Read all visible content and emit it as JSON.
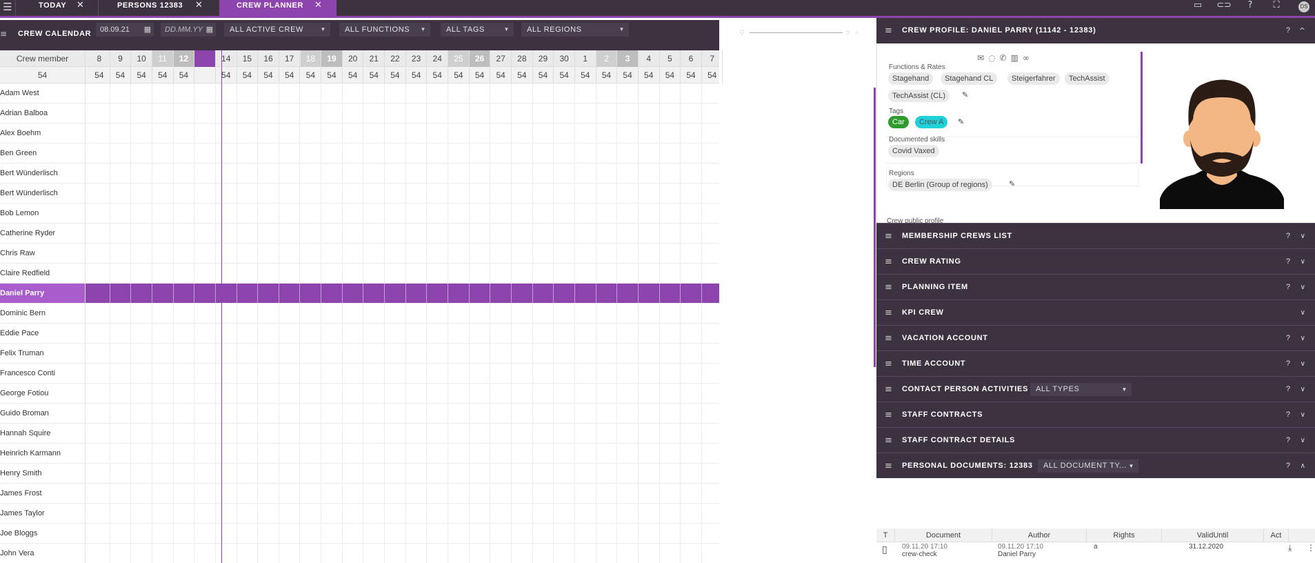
{
  "topbar": {
    "tabs": [
      {
        "label": "TODAY"
      },
      {
        "label": "PERSONS 12383"
      },
      {
        "label": "CREW PLANNER"
      }
    ],
    "close_glyph": "✕",
    "avatar_initials": "DS"
  },
  "toolbar": {
    "title": "CREW CALENDAR",
    "date_from": "08.09.21",
    "date_to_placeholder": "DD.MM.YY",
    "crew_filter": "ALL ACTIVE CREW",
    "function_filter": "ALL FUNCTIONS",
    "tag_filter": "ALL TAGS",
    "region_filter": "ALL REGIONS",
    "help": "?",
    "collapse": "^"
  },
  "calendar": {
    "member_col_header": "Crew member",
    "member_count": "54",
    "days": [
      "8",
      "9",
      "10",
      "11",
      "12",
      "13",
      "14",
      "15",
      "16",
      "17",
      "18",
      "19",
      "20",
      "21",
      "22",
      "23",
      "24",
      "25",
      "26",
      "27",
      "28",
      "29",
      "30",
      "1",
      "2",
      "3",
      "4",
      "5",
      "6",
      "7"
    ],
    "day_counts": [
      "54",
      "54",
      "54",
      "54",
      "54",
      "",
      "54",
      "54",
      "54",
      "54",
      "54",
      "54",
      "54",
      "54",
      "54",
      "54",
      "54",
      "54",
      "54",
      "54",
      "54",
      "54",
      "54",
      "54",
      "54",
      "54",
      "54",
      "54",
      "54",
      "54"
    ],
    "weekend_light": [
      "11",
      "18",
      "25",
      "2"
    ],
    "weekend_dark": [
      "12",
      "19",
      "26",
      "3"
    ],
    "today_day": "13",
    "members": [
      "Adam West",
      "Adrian Balboa",
      "Alex Boehm",
      "Ben Green",
      "Bert Wünderlisch",
      "Bert Wünderlisch",
      "Bob Lemon",
      "Catherine Ryder",
      "Chris Raw",
      "Claire Redfield",
      "Daniel Parry",
      "Dominic Bern",
      "Eddie Pace",
      "Felix Truman",
      "Francesco Conti",
      "George Fotiou",
      "Guido Broman",
      "Hannah Squire",
      "Heinrich Karmann",
      "Henry Smith",
      "James Frost",
      "James Taylor",
      "Joe Bloggs",
      "John Vera"
    ],
    "selected_member": "Daniel Parry"
  },
  "profile": {
    "title": "CREW PROFILE: DANIEL PARRY (11142 - 12383)",
    "help": "?",
    "collapse": "^",
    "contact_icons": [
      "mail-icon",
      "chat-icon",
      "phone-icon",
      "map-icon",
      "link-icon"
    ],
    "functions_label": "Functions & Rates",
    "functions": [
      "Stagehand",
      "Stagehand CL",
      "Steigerfahrer",
      "TechAssist",
      "TechAssist (CL)"
    ],
    "tags_label": "Tags",
    "tags": [
      {
        "label": "Car",
        "color": "#2e9b2e"
      },
      {
        "label": "Crew A",
        "color": "#1fd1d8"
      }
    ],
    "skills_label": "Documented skills",
    "skills": [
      "Covid Vaxed"
    ],
    "regions_label": "Regions",
    "regions": [
      "DE Berlin (Group of regions)"
    ],
    "public_profile": "Crew public profile"
  },
  "sections": [
    {
      "label": "MEMBERSHIP CREWS LIST",
      "help": "?",
      "chevron": "v"
    },
    {
      "label": "CREW RATING",
      "help": "?",
      "chevron": "v"
    },
    {
      "label": "PLANNING ITEM",
      "help": "?",
      "chevron": "v"
    },
    {
      "label": "KPI CREW",
      "help": "",
      "chevron": "v"
    },
    {
      "label": "VACATION ACCOUNT",
      "help": "?",
      "chevron": "v"
    },
    {
      "label": "TIME ACCOUNT",
      "help": "?",
      "chevron": "v"
    },
    {
      "label": "CONTACT PERSON ACTIVITIES",
      "help": "?",
      "chevron": "v",
      "dropdown": "ALL TYPES"
    },
    {
      "label": "STAFF CONTRACTS",
      "help": "?",
      "chevron": "v"
    },
    {
      "label": "STAFF CONTRACT DETAILS",
      "help": "?",
      "chevron": "v"
    },
    {
      "label": "PERSONAL DOCUMENTS: 12383",
      "help": "?",
      "chevron": "^",
      "dropdown": "ALL DOCUMENT TY..."
    }
  ],
  "documents": {
    "columns": [
      "T",
      "Document",
      "Author",
      "Rights",
      "ValidUntil",
      "Act"
    ],
    "rows": [
      {
        "date": "09.11.20 17:10",
        "document": "crew-check",
        "author_date": "09.11.20 17:10",
        "author": "Daniel Parry",
        "rights": "a",
        "valid_until": "31.12.2020"
      }
    ]
  },
  "colors": {
    "accent": "#8e44ad",
    "dark": "#3d3240"
  }
}
